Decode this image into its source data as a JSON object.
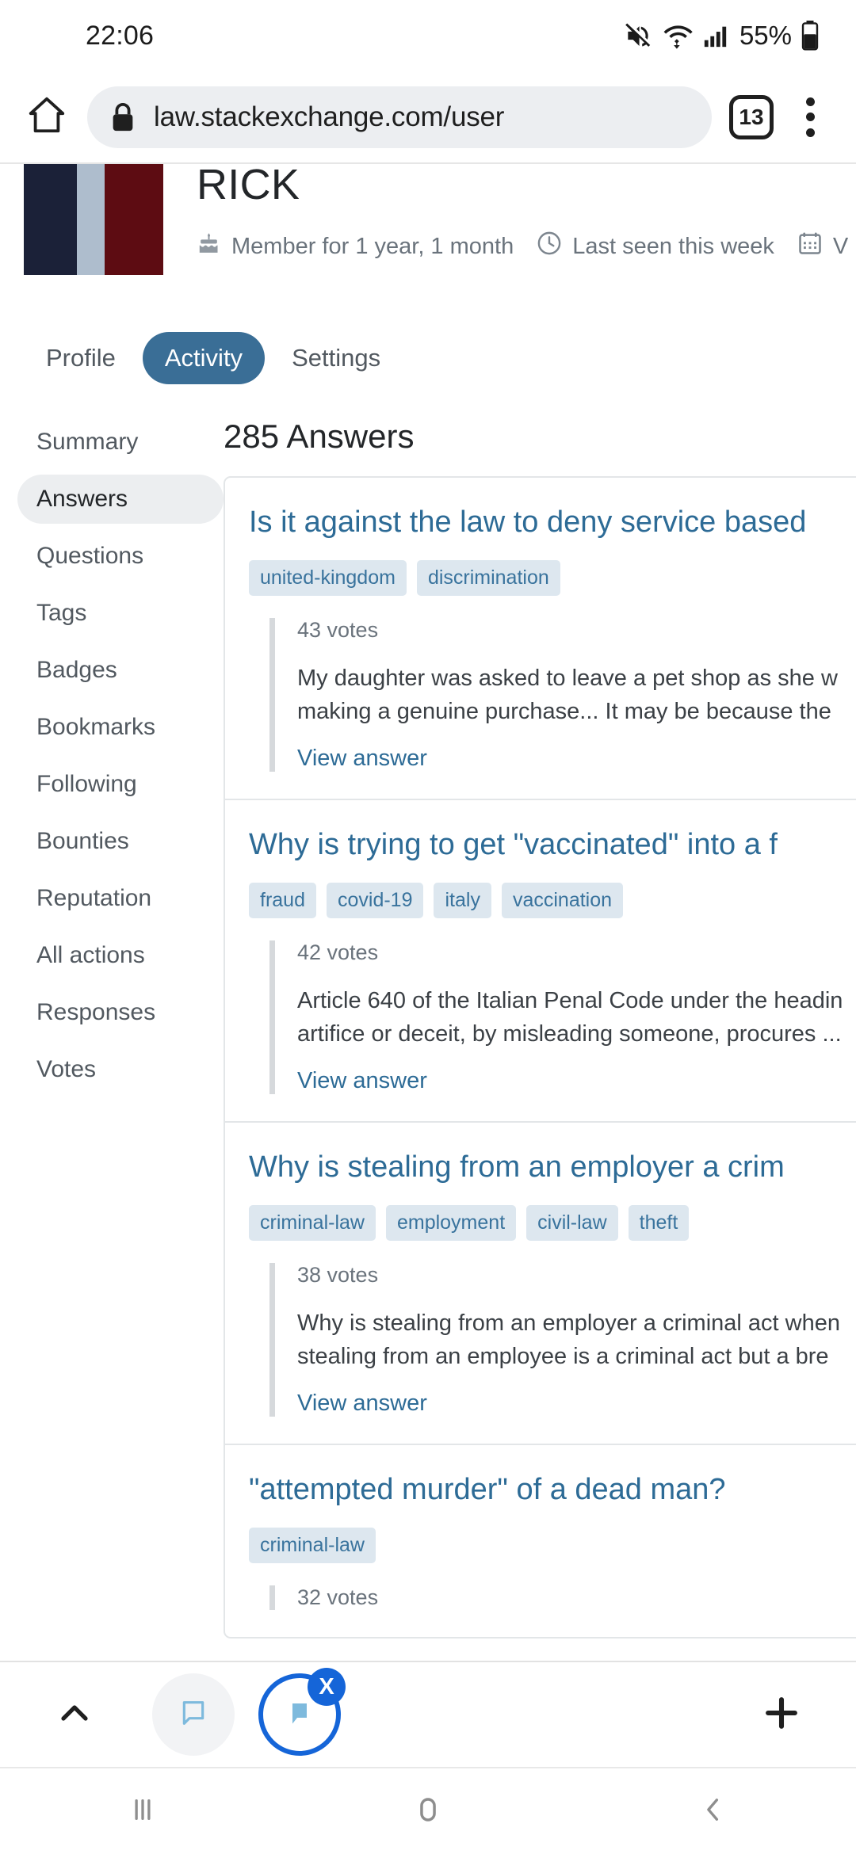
{
  "status_bar": {
    "time": "22:06",
    "battery_percent": "55%",
    "icons": [
      "mute-icon",
      "wifi-icon",
      "signal-icon",
      "battery-icon"
    ]
  },
  "browser": {
    "home_icon": "home-icon",
    "lock_icon": "lock-icon",
    "url": "law.stackexchange.com/user",
    "tab_count": "13",
    "menu_icon": "more-vertical-icon"
  },
  "profile": {
    "display_name": "RICK",
    "avatar_colors": [
      "#1b2138",
      "#aebdcd",
      "#5d0c12"
    ],
    "meta": [
      {
        "icon": "cake-icon",
        "text": "Member for 1 year, 1 month"
      },
      {
        "icon": "clock-icon",
        "text": "Last seen this week"
      },
      {
        "icon": "calendar-icon",
        "text": "V"
      }
    ]
  },
  "tabs": [
    {
      "label": "Profile",
      "active": false
    },
    {
      "label": "Activity",
      "active": true
    },
    {
      "label": "Settings",
      "active": false
    }
  ],
  "sidebar": {
    "items": [
      {
        "label": "Summary",
        "active": false
      },
      {
        "label": "Answers",
        "active": true
      },
      {
        "label": "Questions",
        "active": false
      },
      {
        "label": "Tags",
        "active": false
      },
      {
        "label": "Badges",
        "active": false
      },
      {
        "label": "Bookmarks",
        "active": false
      },
      {
        "label": "Following",
        "active": false
      },
      {
        "label": "Bounties",
        "active": false
      },
      {
        "label": "Reputation",
        "active": false
      },
      {
        "label": "All actions",
        "active": false
      },
      {
        "label": "Responses",
        "active": false
      },
      {
        "label": "Votes",
        "active": false
      }
    ]
  },
  "main": {
    "section_title": "285 Answers",
    "view_answer_label": "View answer",
    "answers": [
      {
        "title": "Is it against the law to deny service based",
        "tags": [
          "united-kingdom",
          "discrimination"
        ],
        "votes": "43 votes",
        "excerpt_line1": "My daughter was asked to leave a pet shop as she w",
        "excerpt_line2": "making a genuine purchase... It may be because the"
      },
      {
        "title": "Why is trying to get \"vaccinated\" into a f",
        "tags": [
          "fraud",
          "covid-19",
          "italy",
          "vaccination"
        ],
        "votes": "42 votes",
        "excerpt_line1": "Article 640 of the Italian Penal Code under the headin",
        "excerpt_line2": "artifice or deceit, by misleading someone, procures ..."
      },
      {
        "title": "Why is stealing from an employer a crim",
        "tags": [
          "criminal-law",
          "employment",
          "civil-law",
          "theft"
        ],
        "votes": "38 votes",
        "excerpt_line1": "Why is stealing from an employer a criminal act when",
        "excerpt_line2": "stealing from an employee is a criminal act but a bre"
      },
      {
        "title": "\"attempted murder\" of a dead man?",
        "tags": [
          "criminal-law"
        ],
        "votes": "32 votes",
        "excerpt_line1": "",
        "excerpt_line2": ""
      }
    ]
  },
  "bottom_bar": {
    "up_icon": "chevron-up-icon",
    "bubble_icon": "speech-bubble-icon",
    "active_tab_icon": "speech-bubble-filled-icon",
    "close_badge": "X",
    "plus_icon": "plus-icon"
  },
  "nav_bar": {
    "recents_icon": "recents-icon",
    "home_icon": "home-circle-icon",
    "back_icon": "back-chevron-icon"
  },
  "colors": {
    "accent_blue": "#3a6e96",
    "link_blue": "#2d6b96",
    "tag_bg": "#dde7ef",
    "tag_text": "#39739d",
    "chrome_blue": "#1565d8"
  }
}
